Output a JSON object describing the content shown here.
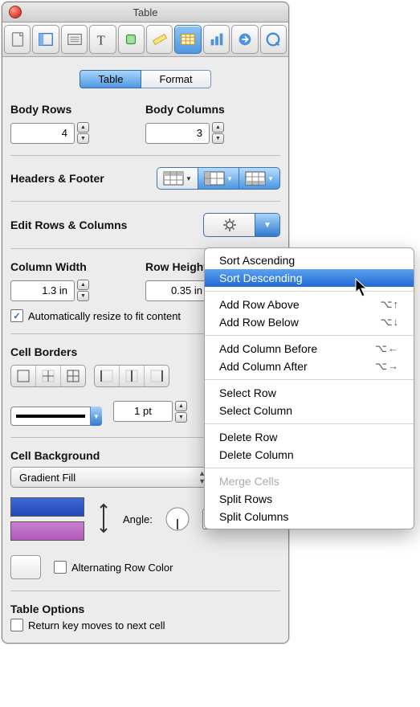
{
  "title": "Table",
  "tabs": {
    "table": "Table",
    "format": "Format"
  },
  "body_rows": {
    "label": "Body Rows",
    "value": "4"
  },
  "body_columns": {
    "label": "Body Columns",
    "value": "3"
  },
  "headers_footer": "Headers & Footer",
  "edit_rows_cols": "Edit Rows & Columns",
  "column_width": {
    "label": "Column Width",
    "value": "1.3 in"
  },
  "row_height": {
    "label": "Row Height",
    "value": "0.35 in"
  },
  "auto_resize": "Automatically resize to fit content",
  "cell_borders": "Cell Borders",
  "stroke_width": "1 pt",
  "cell_background": "Cell Background",
  "bg_type": "Gradient Fill",
  "angle_label": "Angle:",
  "angle_value": "270",
  "alt_row": "Alternating Row Color",
  "table_options": "Table Options",
  "return_key": "Return key moves to next cell",
  "menu": {
    "sort_asc": "Sort Ascending",
    "sort_desc": "Sort Descending",
    "add_row_above": "Add Row Above",
    "add_row_below": "Add Row Below",
    "add_col_before": "Add Column Before",
    "add_col_after": "Add Column After",
    "select_row": "Select Row",
    "select_col": "Select Column",
    "delete_row": "Delete Row",
    "delete_col": "Delete Column",
    "merge": "Merge Cells",
    "split_rows": "Split Rows",
    "split_cols": "Split Columns",
    "sc_row_above": "⌥↑",
    "sc_row_below": "⌥↓",
    "sc_col_before": "⌥←",
    "sc_col_after": "⌥→"
  }
}
